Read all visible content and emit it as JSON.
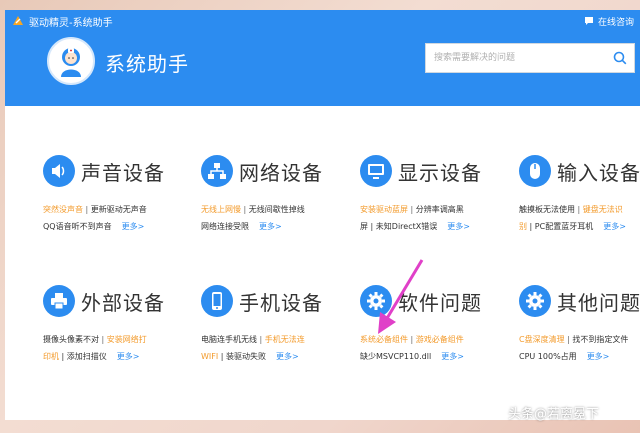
{
  "window": {
    "title": "驱动精灵-系统助手",
    "help_label": "在线咨询"
  },
  "header": {
    "title": "系统助手",
    "search_placeholder": "搜索需要解决的问题"
  },
  "categories": [
    {
      "name": "声音设备",
      "icon": "speaker-icon",
      "line1": [
        {
          "text": "突然没声音",
          "style": "orange"
        },
        {
          "text": " | ",
          "style": "sep"
        },
        {
          "text": "更新驱动无声音",
          "style": "normal"
        }
      ],
      "line2": [
        {
          "text": "QQ语音听不到声音",
          "style": "normal"
        }
      ],
      "more": "更多>"
    },
    {
      "name": "网络设备",
      "icon": "network-icon",
      "line1": [
        {
          "text": "无线上网慢",
          "style": "orange"
        },
        {
          "text": " | ",
          "style": "sep"
        },
        {
          "text": "无线间歇性掉线",
          "style": "normal"
        }
      ],
      "line2": [
        {
          "text": "网络连接受限",
          "style": "normal"
        }
      ],
      "more": "更多>"
    },
    {
      "name": "显示设备",
      "icon": "monitor-icon",
      "line1": [
        {
          "text": "安装驱动蓝屏",
          "style": "orange"
        },
        {
          "text": " | ",
          "style": "sep"
        },
        {
          "text": "分辨率调高黑",
          "style": "normal"
        }
      ],
      "line2": [
        {
          "text": "屏 | 未知DirectX错误",
          "style": "normal"
        }
      ],
      "more": "更多>"
    },
    {
      "name": "输入设备",
      "icon": "mouse-icon",
      "line1": [
        {
          "text": "触摸板无法使用",
          "style": "normal"
        },
        {
          "text": " | ",
          "style": "sep"
        },
        {
          "text": "键盘无法识",
          "style": "orange"
        }
      ],
      "line2": [
        {
          "text": "别",
          "style": "orange"
        },
        {
          "text": " | PC配置蓝牙耳机",
          "style": "normal"
        }
      ],
      "more": "更多>"
    },
    {
      "name": "外部设备",
      "icon": "printer-icon",
      "line1": [
        {
          "text": "摄像头像素不对",
          "style": "normal"
        },
        {
          "text": " | ",
          "style": "sep"
        },
        {
          "text": "安装网络打",
          "style": "orange"
        }
      ],
      "line2": [
        {
          "text": "印机",
          "style": "orange"
        },
        {
          "text": " | 添加扫描仪",
          "style": "normal"
        }
      ],
      "more": "更多>"
    },
    {
      "name": "手机设备",
      "icon": "phone-icon",
      "line1": [
        {
          "text": "电脑连手机无线",
          "style": "normal"
        },
        {
          "text": " | ",
          "style": "sep"
        },
        {
          "text": "手机无法连",
          "style": "orange"
        }
      ],
      "line2": [
        {
          "text": "WIFI",
          "style": "orange"
        },
        {
          "text": " | 装驱动失败",
          "style": "normal"
        }
      ],
      "more": "更多>"
    },
    {
      "name": "软件问题",
      "icon": "gear-icon",
      "line1": [
        {
          "text": "系统必备组件",
          "style": "orange"
        },
        {
          "text": " | ",
          "style": "sep"
        },
        {
          "text": "游戏必备组件",
          "style": "orange"
        }
      ],
      "line2": [
        {
          "text": "缺少MSVCP110.dll",
          "style": "normal"
        }
      ],
      "more": "更多>"
    },
    {
      "name": "其他问题",
      "icon": "settings-icon",
      "line1": [
        {
          "text": "C盘深度清理",
          "style": "orange"
        },
        {
          "text": " | ",
          "style": "sep"
        },
        {
          "text": "找不到指定文件",
          "style": "normal"
        }
      ],
      "line2": [
        {
          "text": "CPU 100%占用",
          "style": "normal"
        }
      ],
      "more": "更多>"
    }
  ],
  "watermark": "头条@若离冕下",
  "colors": {
    "brand_blue": "#2c8cf0",
    "link_orange": "#f39b2c",
    "annotation_arrow": "#e040c8"
  }
}
